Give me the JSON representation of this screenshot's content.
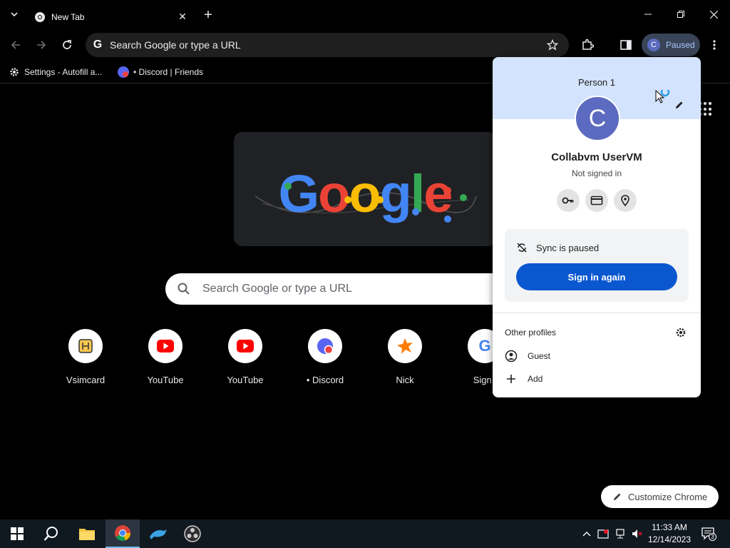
{
  "tab": {
    "title": "New Tab"
  },
  "omnibox": {
    "placeholder": "Search Google or type a URL"
  },
  "profile_chip": {
    "avatar_letter": "C",
    "label": "Paused"
  },
  "bookmarks": [
    {
      "label": "Settings - Autofill a...",
      "icon": "gear-icon"
    },
    {
      "label": "• Discord | Friends",
      "icon": "discord-icon"
    }
  ],
  "ntp": {
    "search_placeholder": "Search Google or type a URL",
    "doodle_text": "Google",
    "shortcuts": [
      {
        "label": "Vsimcard",
        "icon": "simcard-icon"
      },
      {
        "label": "YouTube",
        "icon": "youtube-icon"
      },
      {
        "label": "YouTube",
        "icon": "youtube-icon"
      },
      {
        "label": "• Discord",
        "icon": "discord-icon"
      },
      {
        "label": "Nick",
        "icon": "nick-icon"
      },
      {
        "label": "Sign i",
        "icon": "google-icon"
      }
    ],
    "customize_label": "Customize Chrome"
  },
  "profile_menu": {
    "person": "Person 1",
    "avatar_letter": "C",
    "name": "Collabvm UserVM",
    "status": "Not signed in",
    "sync_text": "Sync is paused",
    "sign_in_label": "Sign in again",
    "other_profiles_label": "Other profiles",
    "guest_label": "Guest",
    "add_label": "Add"
  },
  "taskbar": {
    "time": "11:33 AM",
    "date": "12/14/2023",
    "notifications": "3"
  },
  "colors": {
    "accent_blue": "#0b57d0",
    "popup_header": "#d3e3fd",
    "avatar": "#5c6bc0",
    "chip_bg": "#394457",
    "chip_text": "#a8c7fa"
  }
}
